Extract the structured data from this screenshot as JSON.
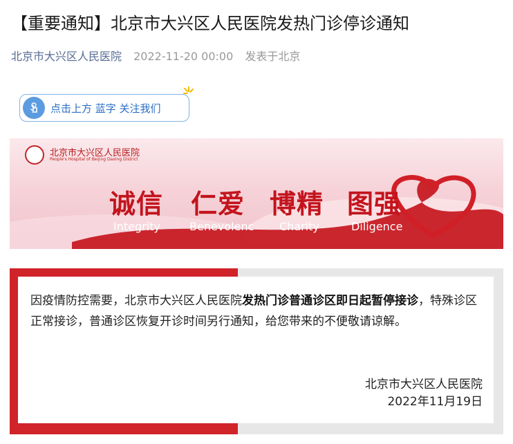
{
  "article": {
    "title": "【重要通知】北京市大兴区人民医院发热门诊停诊通知",
    "account_name": "北京市大兴区人民医院",
    "publish_time": "2022-11-20 00:00",
    "location": "发表于北京"
  },
  "follow_prompt": {
    "label": "点击上方 蓝字 关注我们",
    "icon": "hand-tap-icon"
  },
  "banner": {
    "hospital_name_cn": "北京市大兴区人民医院",
    "hospital_name_en": "People's Hospital of Beijing Daxing District",
    "values": [
      {
        "cn": "诚信",
        "en": "Integrity"
      },
      {
        "cn": "仁爱",
        "en": "Benevolenc"
      },
      {
        "cn": "博精",
        "en": "Charity"
      },
      {
        "cn": "图强",
        "en": "Diligence"
      }
    ]
  },
  "notice": {
    "text_before": "因疫情防控需要，北京市大兴区人民医院",
    "text_bold": "发热门诊普通诊区即日起暂停接诊",
    "text_after": "，特殊诊区正常接诊，普通诊区恢复开诊时间另行通知，给您带来的不便敬请谅解。",
    "signature": "北京市大兴区人民医院",
    "date": "2022年11月19日"
  },
  "colors": {
    "accent_red": "#d1232a",
    "link_blue": "#576b95"
  }
}
